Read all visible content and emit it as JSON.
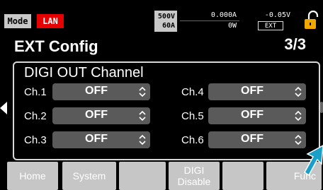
{
  "status": {
    "mode_label": "Mode",
    "interface_label": "LAN",
    "rating_voltage": "500V",
    "rating_current": "60A",
    "measured_current": "0.000A",
    "measured_power": "0W",
    "measured_voltage": "-0.05V",
    "control_source": "EXT",
    "colors": {
      "interface_bg": "#e60000",
      "lock": "#f0a800",
      "accent": "#1aa0c8"
    }
  },
  "header": {
    "title": "EXT Config",
    "page": "3/3"
  },
  "panel": {
    "title": "DIGI OUT Channel",
    "channels": [
      {
        "label": "Ch.1",
        "value": "OFF"
      },
      {
        "label": "Ch.2",
        "value": "OFF"
      },
      {
        "label": "Ch.3",
        "value": "OFF"
      },
      {
        "label": "Ch.4",
        "value": "OFF"
      },
      {
        "label": "Ch.5",
        "value": "OFF"
      },
      {
        "label": "Ch.6",
        "value": "OFF"
      }
    ]
  },
  "function_bar": {
    "home": "Home",
    "system": "System",
    "digi_line1": "DIGI",
    "digi_line2": "Disable",
    "func": "Func"
  },
  "icons": {
    "lock": "unlock-icon",
    "spinner": "up-down-chevron-icon",
    "prev": "left-arrow-icon",
    "cursor": "pointer-arrow-icon"
  }
}
